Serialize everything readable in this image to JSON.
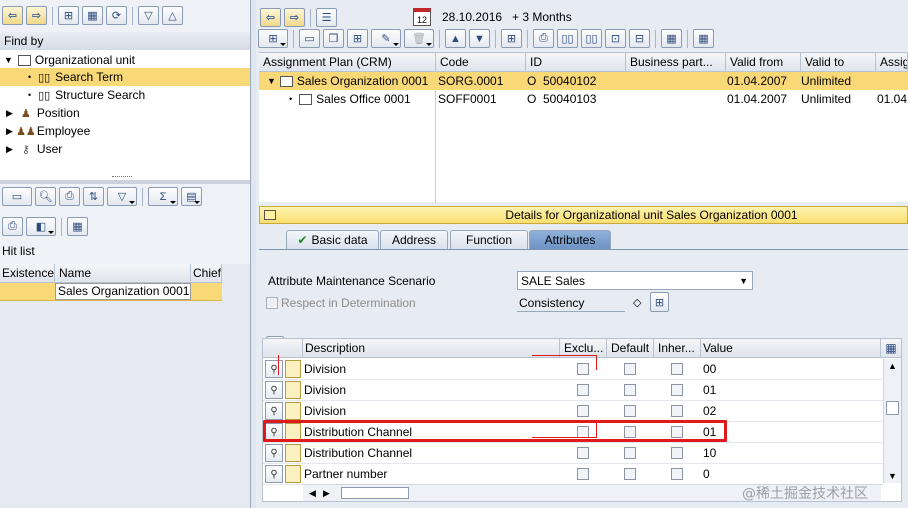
{
  "left": {
    "find_by_label": "Find by",
    "tree": [
      {
        "label": "Organizational unit",
        "icon": "org-unit-icon"
      },
      {
        "label": "Search Term",
        "icon": "binoculars-icon"
      },
      {
        "label": "Structure Search",
        "icon": "binoculars-icon"
      },
      {
        "label": "Position",
        "icon": "person-icon"
      },
      {
        "label": "Employee",
        "icon": "people-icon"
      },
      {
        "label": "User",
        "icon": "key-icon"
      }
    ],
    "hit_list_label": "Hit list",
    "hit_columns": [
      "Existence",
      "Name",
      "Chief"
    ],
    "hit_rows": [
      {
        "name": "Sales Organization 0001"
      }
    ]
  },
  "top": {
    "date": "28.10.2016",
    "period": "+ 3 Months"
  },
  "structure": {
    "columns": [
      "Assignment Plan (CRM)",
      "Code",
      "ID",
      "Business part...",
      "Valid from",
      "Valid to",
      "Assig"
    ],
    "rows": [
      {
        "name": "Sales Organization 0001",
        "code": "SORG.0001",
        "type": "O",
        "id": "50040102",
        "valid_from": "01.04.2007",
        "valid_to": "Unlimited",
        "assig": ""
      },
      {
        "name": "Sales Office 0001",
        "code": "SOFF0001",
        "type": "O",
        "id": "50040103",
        "valid_from": "01.04.2007",
        "valid_to": "Unlimited",
        "assig": "01.04"
      }
    ]
  },
  "details": {
    "title": "Details for Organizational unit Sales Organization 0001",
    "tabs": [
      "Basic data",
      "Address",
      "Function",
      "Attributes"
    ],
    "active_tab": "Attributes",
    "scenario_label": "Attribute Maintenance Scenario",
    "scenario_value": "SALE Sales",
    "respect_label": "Respect in Determination",
    "consistency_label": "Consistency",
    "attr_columns": [
      "Description",
      "Exclu...",
      "Default",
      "Inher...",
      "Value"
    ],
    "attr_rows": [
      {
        "description": "Division",
        "value": "00"
      },
      {
        "description": "Division",
        "value": "01"
      },
      {
        "description": "Division",
        "value": "02"
      },
      {
        "description": "Distribution Channel",
        "value": "01"
      },
      {
        "description": "Distribution Channel",
        "value": "10"
      },
      {
        "description": "Partner number",
        "value": "0"
      }
    ],
    "highlight_color": "#e0191b"
  },
  "watermark": "@稀土掘金技术社区"
}
